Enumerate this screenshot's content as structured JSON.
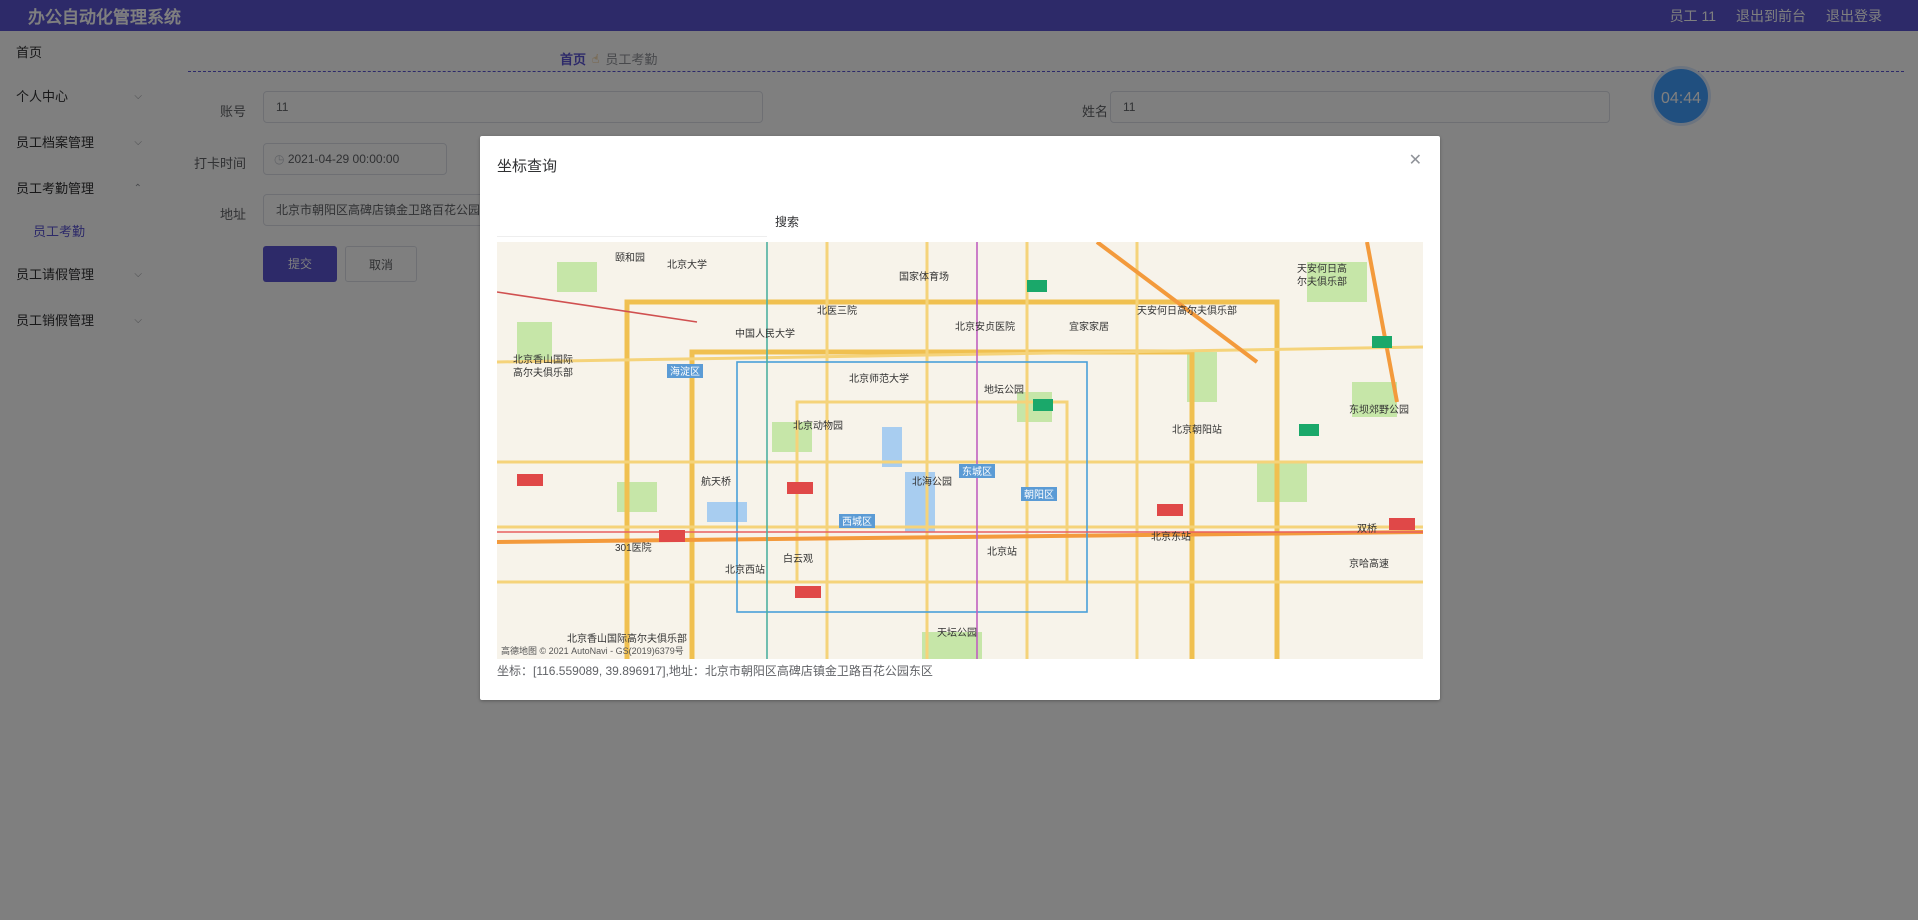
{
  "app": {
    "title": "办公自动化管理系统"
  },
  "top_right": {
    "user": "员工 11",
    "front": "退出到前台",
    "logout": "退出登录"
  },
  "sidebar": {
    "items": [
      {
        "label": "首页"
      },
      {
        "label": "个人中心"
      },
      {
        "label": "员工档案管理"
      },
      {
        "label": "员工考勤管理"
      },
      {
        "label": "员工请假管理"
      },
      {
        "label": "员工销假管理"
      }
    ],
    "sub_item": "员工考勤"
  },
  "breadcrumb": {
    "home": "首页",
    "current": "员工考勤"
  },
  "form": {
    "account_label": "账号",
    "account_value": "11",
    "name_label": "姓名",
    "name_value": "11",
    "time_label": "打卡时间",
    "time_value": "2021-04-29 00:00:00",
    "address_label": "地址",
    "address_value": "北京市朝阳区高碑店镇金卫路百花公园东",
    "submit": "提交",
    "cancel": "取消"
  },
  "timer": "04:44",
  "dialog": {
    "title": "坐标查询",
    "search_button": "搜索",
    "coord_text": "坐标：[116.559089, 39.896917],地址：北京市朝阳区高碑店镇金卫路百花公园东区",
    "map_copyright": "高德地图 © 2021 AutoNavi - GS(2019)6379号"
  },
  "map": {
    "labels": [
      "颐和园",
      "北京大学",
      "国家体育场",
      "北医三院",
      "中国人民大学",
      "北京安贞医院",
      "宜家家居",
      "天安何日高尔夫俱乐部",
      "北京香山国际高尔夫俱乐部",
      "海淀区",
      "北京师范大学",
      "地坛公园",
      "北京动物园",
      "北京朝阳站",
      "东坝郊野公园",
      "东城区",
      "北海公园",
      "朝阳区",
      "西城区",
      "航天桥",
      "301医院",
      "白云观",
      "北京站",
      "北京东站",
      "北京西站",
      "天坛公园",
      "京哈高速",
      "双桥"
    ]
  }
}
